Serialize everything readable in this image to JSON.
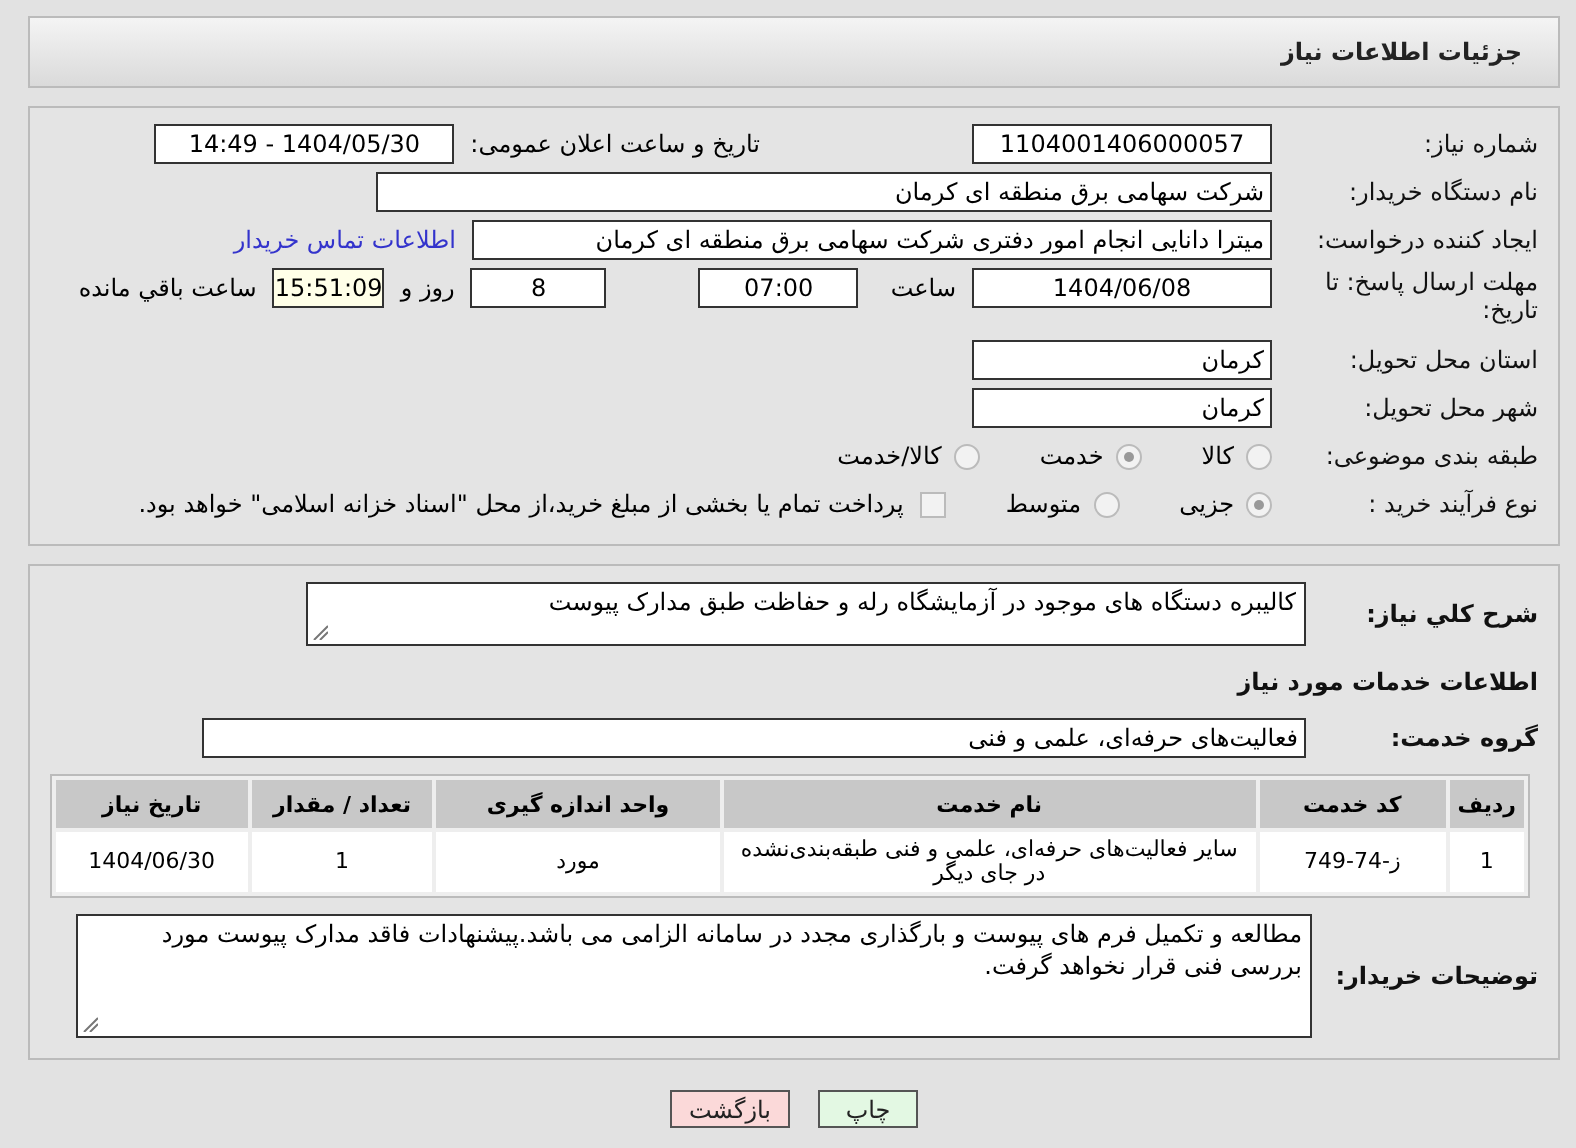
{
  "header": {
    "title": "جزئيات اطلاعات نیاز"
  },
  "fields": {
    "need_number_label": "شماره نیاز:",
    "need_number": "1104001406000057",
    "announce_label": "تاریخ و ساعت اعلان عمومی:",
    "announce_value": "1404/05/30 - 14:49",
    "buyer_label": "نام دستگاه خریدار:",
    "buyer": "شرکت سهامی برق منطقه ای کرمان",
    "creator_label": "ایجاد کننده درخواست:",
    "creator": "میترا دانایی انجام امور دفتری شرکت سهامی برق منطقه ای کرمان",
    "contact_link": "اطلاعات تماس خریدار",
    "deadline_label": "مهلت ارسال پاسخ: تا تاریخ:",
    "deadline_date": "1404/06/08",
    "time_label": "ساعت",
    "deadline_time": "07:00",
    "days": "8",
    "days_label": "روز و",
    "remaining": "15:51:09",
    "remaining_label": "ساعت باقي مانده",
    "province_label": "استان محل تحویل:",
    "province": "کرمان",
    "city_label": "شهر محل تحویل:",
    "city": "کرمان"
  },
  "category": {
    "label": "طبقه بندی موضوعی:",
    "options": [
      {
        "label": "کالا",
        "selected": false
      },
      {
        "label": "خدمت",
        "selected": true
      },
      {
        "label": "کالا/خدمت",
        "selected": false
      }
    ]
  },
  "purchase_type": {
    "label": "نوع فرآیند خرید :",
    "options": [
      {
        "label": "جزیی",
        "selected": true
      },
      {
        "label": "متوسط",
        "selected": false
      }
    ],
    "payment_checkbox": {
      "checked": false,
      "label": "پرداخت تمام یا بخشی از مبلغ خرید،از محل \"اسناد خزانه اسلامی\" خواهد بود."
    }
  },
  "summary": {
    "label": "شرح کلي نياز:",
    "value": "کالیبره دستگاه های موجود در آزمایشگاه رله و حفاظت طبق مدارک پیوست"
  },
  "services_title": "اطلاعات خدمات مورد نياز",
  "service_group": {
    "label": "گروه خدمت:",
    "value": "فعالیت‌های حرفه‌ای، علمی و فنی"
  },
  "table": {
    "columns": [
      "ردیف",
      "کد خدمت",
      "نام خدمت",
      "واحد اندازه گیری",
      "تعداد / مقدار",
      "تاریخ نیاز"
    ],
    "rows": [
      [
        "1",
        "ز-74-749",
        "سایر فعالیت‌های حرفه‌ای، علمی و فنی طبقه‌بندی‌نشده در جای دیگر",
        "مورد",
        "1",
        "1404/06/30"
      ]
    ]
  },
  "buyer_notes": {
    "label": "توضیحات خریدار:",
    "value": "مطالعه و تکمیل فرم های پیوست و بارگذاری مجدد در سامانه الزامی می باشد.پیشنهادات فاقد مدارک پیوست مورد بررسی فنی قرار نخواهد گرفت."
  },
  "buttons": [
    {
      "kind": "print",
      "label": "چاپ"
    },
    {
      "kind": "back",
      "label": "بازگشت"
    }
  ]
}
